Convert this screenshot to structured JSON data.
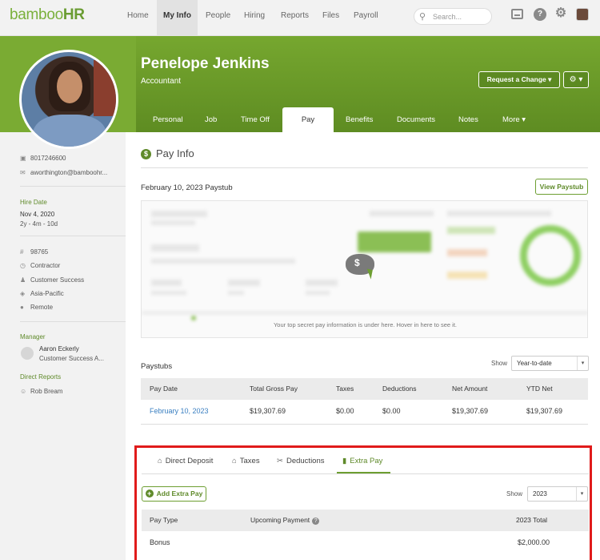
{
  "app": {
    "logo_text": "bamboo",
    "logo_hr": "HR",
    "nav": [
      "Home",
      "My Info",
      "People",
      "Hiring",
      "Reports",
      "Files",
      "Payroll"
    ],
    "active_nav": "My Info",
    "search_placeholder": "Search..."
  },
  "header": {
    "name": "Penelope Jenkins",
    "title": "Accountant",
    "request_change_label": "Request a Change",
    "tabs": [
      "Personal",
      "Job",
      "Time Off",
      "Pay Info",
      "Benefits",
      "Documents",
      "Notes",
      "More"
    ],
    "active_tab": "Pay Info"
  },
  "sidebar": {
    "phone": "8017246600",
    "email": "aworthington@bamboohr...",
    "hire_date_label": "Hire Date",
    "hire_date": "Nov 4, 2020",
    "tenure": "2y - 4m - 10d",
    "employee_number": "98765",
    "employment_type": "Contractor",
    "department": "Customer Success",
    "region": "Asia-Pacific",
    "location": "Remote",
    "manager_label": "Manager",
    "manager_name": "Aaron Eckerly",
    "manager_title": "Customer Success A...",
    "direct_reports_label": "Direct Reports",
    "direct_report_name": "Rob Bream"
  },
  "pay_info": {
    "section_title": "Pay Info",
    "paystub_title": "February 10, 2023 Paystub",
    "view_paystub_label": "View Paystub",
    "secret_message": "Your top secret pay information is under here. Hover in here to see it."
  },
  "paystubs": {
    "title": "Paystubs",
    "show_label": "Show",
    "show_value": "Year-to-date",
    "columns": [
      "Pay Date",
      "Total Gross Pay",
      "Taxes",
      "Deductions",
      "Net Amount",
      "YTD Net"
    ],
    "rows": [
      [
        "February 10, 2023",
        "$19,307.69",
        "$0.00",
        "$0.00",
        "$19,307.69",
        "$19,307.69"
      ]
    ]
  },
  "extra_pay": {
    "tabs": [
      "Direct Deposit",
      "Taxes",
      "Deductions",
      "Extra Pay"
    ],
    "active_tab": "Extra Pay",
    "add_label": "Add Extra Pay",
    "show_label": "Show",
    "show_value": "2023",
    "columns": [
      "Pay Type",
      "Upcoming Payment",
      "2023 Total"
    ],
    "rows": [
      [
        "Bonus",
        "",
        "$2,000.00"
      ]
    ]
  },
  "colors": {
    "brand_green": "#6a9a2a",
    "highlight_red": "#e01b1b",
    "link_blue": "#3a7fc1"
  }
}
